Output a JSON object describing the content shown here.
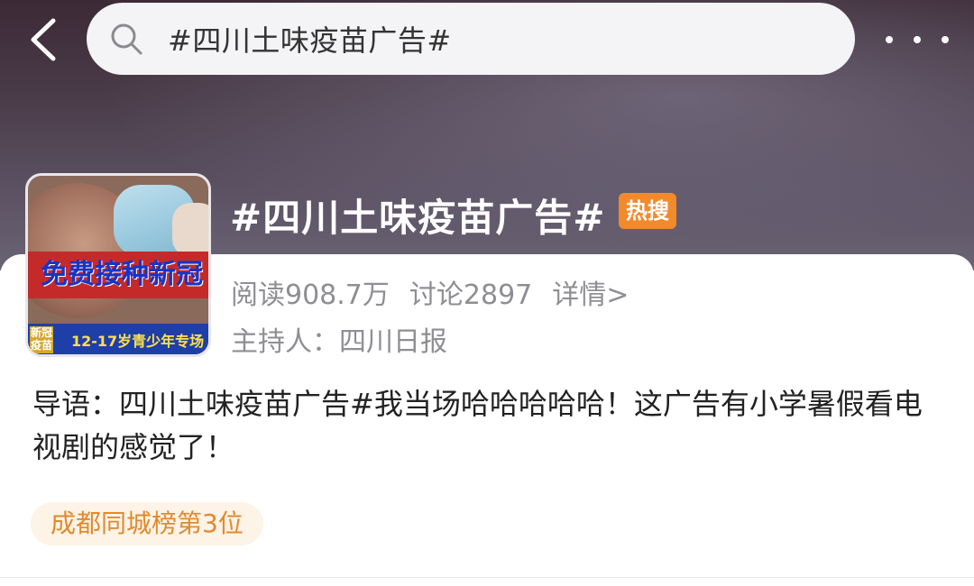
{
  "search": {
    "query": "#四川土味疫苗广告#"
  },
  "topic": {
    "title": "#四川土味疫苗广告#",
    "badge": "热搜",
    "reads": "阅读908.7万",
    "discussions": "讨论2897",
    "details_link": "详情>",
    "host": "主持人：四川日报",
    "intro": "导语：四川土味疫苗广告#我当场哈哈哈哈哈！这广告有小学暑假看电视剧的感觉了！",
    "rank": "成都同城榜第3位"
  },
  "thumbnail": {
    "banner_text": "免费接种新冠",
    "corner_tag": "新冠\n疫苗",
    "subtitle": "12-17岁青少年专场"
  },
  "colors": {
    "badge": "#f28a2c",
    "rank_text": "#e08a2e",
    "rank_bg": "#fdf3e6",
    "meta_text": "#8e8e93"
  },
  "icons": {
    "back": "back-arrow-icon",
    "search": "search-icon",
    "more": "more-dots-icon"
  }
}
